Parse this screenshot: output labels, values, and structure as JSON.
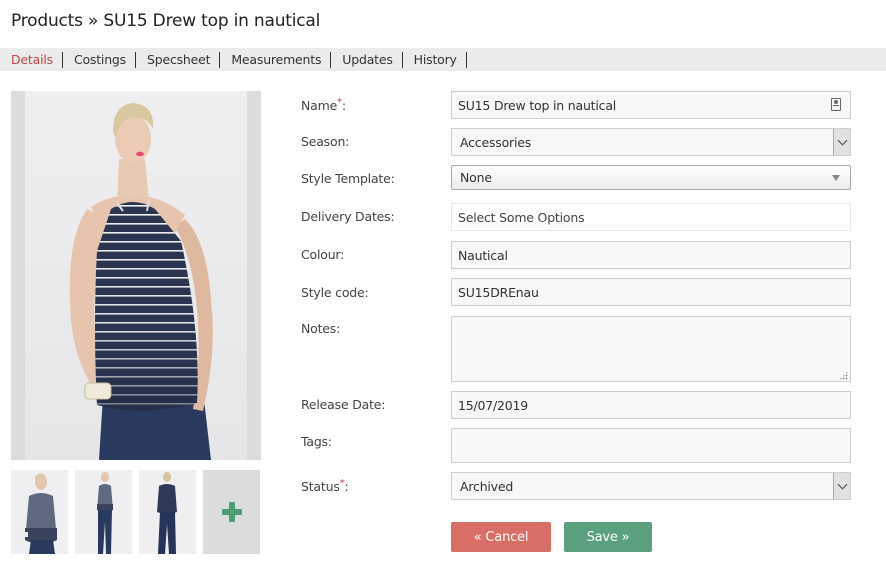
{
  "page": {
    "title": "Products » SU15 Drew top in nautical"
  },
  "tabs": [
    {
      "label": "Details",
      "active": true
    },
    {
      "label": "Costings",
      "active": false
    },
    {
      "label": "Specsheet",
      "active": false
    },
    {
      "label": "Measurements",
      "active": false
    },
    {
      "label": "Updates",
      "active": false
    },
    {
      "label": "History",
      "active": false
    }
  ],
  "images": {
    "main_alt": "Model wearing navy and white striped halter top",
    "thumbnails": [
      {
        "alt": "Front close-up of striped top"
      },
      {
        "alt": "Full length front view"
      },
      {
        "alt": "Full length back view"
      }
    ],
    "add_icon": "plus-icon"
  },
  "form": {
    "name": {
      "label": "Name",
      "required_mark": "*",
      "suffix": ":",
      "value": "SU15 Drew top in nautical",
      "icon": "contact-card-icon"
    },
    "season": {
      "label": "Season:",
      "value": "Accessories"
    },
    "style_template": {
      "label": "Style Template:",
      "value": "None"
    },
    "delivery_dates": {
      "label": "Delivery Dates:",
      "placeholder": "Select Some Options"
    },
    "colour": {
      "label": "Colour:",
      "value": "Nautical"
    },
    "style_code": {
      "label": "Style code:",
      "value": "SU15DREnau"
    },
    "notes": {
      "label": "Notes:",
      "value": ""
    },
    "release_date": {
      "label": "Release Date:",
      "value": "15/07/2019"
    },
    "tags": {
      "label": "Tags:",
      "value": ""
    },
    "status": {
      "label": "Status",
      "required_mark": "*",
      "suffix": ":",
      "value": "Archived"
    }
  },
  "buttons": {
    "cancel": "« Cancel",
    "save": "Save »"
  },
  "colors": {
    "active_tab": "#c0464b",
    "cancel": "#d86e66",
    "save": "#5aa07f",
    "plus": "#4d9e73"
  }
}
